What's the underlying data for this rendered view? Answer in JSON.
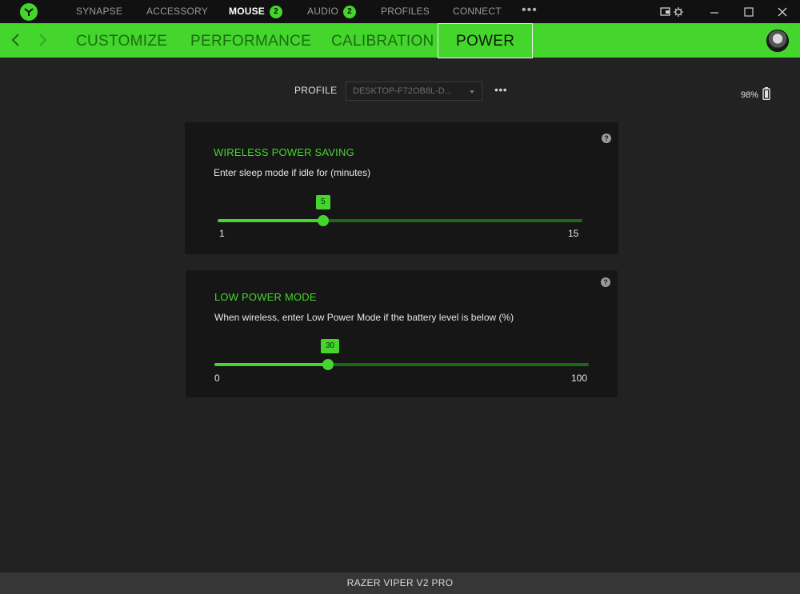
{
  "top_nav": {
    "items": [
      {
        "label": "SYNAPSE"
      },
      {
        "label": "ACCESSORY"
      },
      {
        "label": "MOUSE",
        "badge": "2"
      },
      {
        "label": "AUDIO",
        "badge": "2"
      },
      {
        "label": "PROFILES"
      },
      {
        "label": "CONNECT"
      }
    ],
    "more": "•••"
  },
  "sub_nav": {
    "tabs": [
      {
        "label": "CUSTOMIZE"
      },
      {
        "label": "PERFORMANCE"
      },
      {
        "label": "CALIBRATION"
      },
      {
        "label": "POWER"
      }
    ],
    "active": "POWER"
  },
  "profile": {
    "label": "PROFILE",
    "selected": "DESKTOP-F72OB8L-D...",
    "more": "•••"
  },
  "battery": {
    "level_text": "98%"
  },
  "wireless_power_saving": {
    "title": "WIRELESS POWER SAVING",
    "description": "Enter sleep mode if idle for (minutes)",
    "value": "5",
    "min": "1",
    "max": "15",
    "help": "?"
  },
  "low_power_mode": {
    "title": "LOW POWER MODE",
    "description": "When wireless, enter Low Power Mode if the battery level is below (%)",
    "value": "30",
    "min": "0",
    "max": "100",
    "help": "?"
  },
  "footer": {
    "device_name": "RAZER VIPER V2 PRO"
  },
  "colors": {
    "accent": "#44d62c",
    "accent_dark": "#1c6b12",
    "background": "#222222",
    "card": "#161616"
  }
}
